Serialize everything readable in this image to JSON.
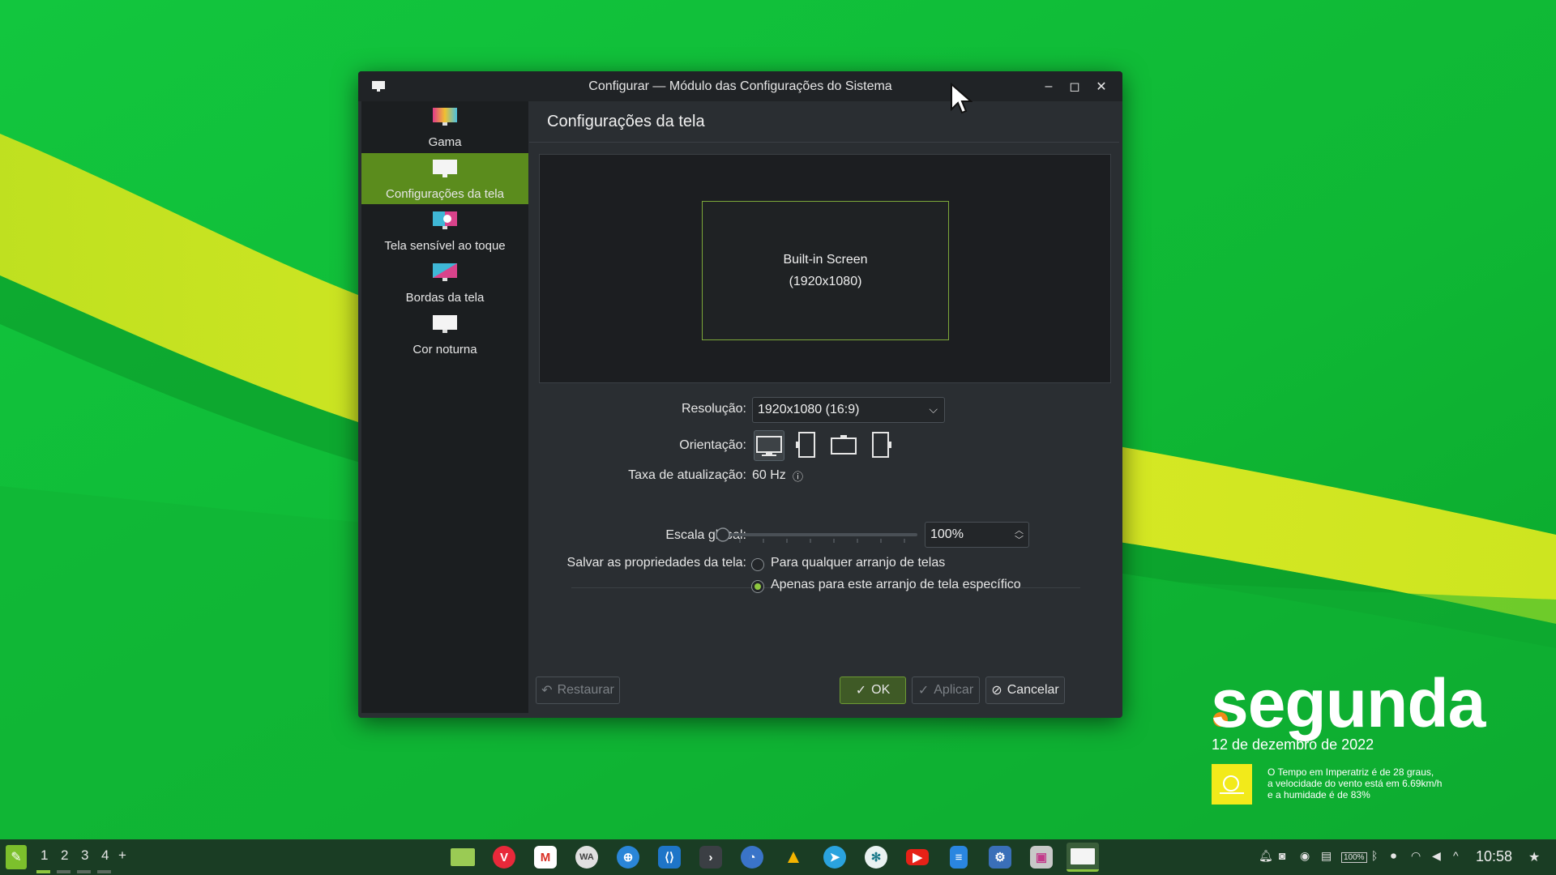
{
  "window": {
    "title": "Configurar — Módulo das Configurações do Sistema",
    "sidebar": [
      {
        "label": "Gama",
        "icon": "gamma-icon"
      },
      {
        "label": "Configurações da tela",
        "icon": "display-icon",
        "active": true
      },
      {
        "label": "Tela sensível ao toque",
        "icon": "touchscreen-icon"
      },
      {
        "label": "Bordas da tela",
        "icon": "screen-edges-icon"
      },
      {
        "label": "Cor noturna",
        "icon": "night-color-icon"
      }
    ],
    "page_title": "Configurações da tela",
    "output": {
      "name": "Built-in Screen",
      "resolution": "(1920x1080)"
    },
    "resolution_label": "Resolução:",
    "resolution_value": "1920x1080 (16:9)",
    "orientation_label": "Orientação:",
    "refresh_label": "Taxa de atualização:",
    "refresh_value": "60 Hz",
    "scale_label": "Escala global:",
    "scale_value": "100%",
    "save_label": "Salvar as propriedades da tela:",
    "save_options": [
      "Para qualquer arranjo de telas",
      "Apenas para este arranjo de tela específico"
    ],
    "save_selected": 1,
    "buttons": {
      "restore": "Restaurar",
      "ok": "OK",
      "apply": "Aplicar",
      "cancel": "Cancelar"
    }
  },
  "widget": {
    "day": "segunda",
    "date": "12 de dezembro de 2022",
    "weather_lines": [
      "O Tempo em Imperatriz é de 28 graus,",
      "a velocidade do vento está em 6.69km/h",
      "e a humidade é de 83%"
    ]
  },
  "taskbar": {
    "desktops": [
      "1",
      "2",
      "3",
      "4"
    ],
    "add_desktop": "+",
    "active_desktop": 0,
    "apps": [
      "file-manager-icon",
      "vivaldi-icon",
      "gmail-icon",
      "whatsapp-icon",
      "network-icon",
      "vscode-icon",
      "terminal-icon",
      "clock-icon",
      "google-drive-icon",
      "telegram-icon",
      "xmpp-icon",
      "youtube-icon",
      "document-icon",
      "system-monitor-icon",
      "image-viewer-icon",
      "display-settings-icon"
    ],
    "tray": [
      "notifications-icon",
      "discord-icon",
      "vpn-icon",
      "clipboard-icon",
      "battery-icon",
      "bluetooth-icon",
      "microphone-icon",
      "wifi-icon",
      "volume-icon",
      "expand-tray-icon"
    ],
    "battery_text": "100%",
    "clock": "10:58"
  },
  "colors": {
    "accent": "#8ec63f",
    "selection": "#5b8c1d",
    "wallpaper_green": "#12c23a",
    "wallpaper_yellow": "#d9e81e"
  }
}
